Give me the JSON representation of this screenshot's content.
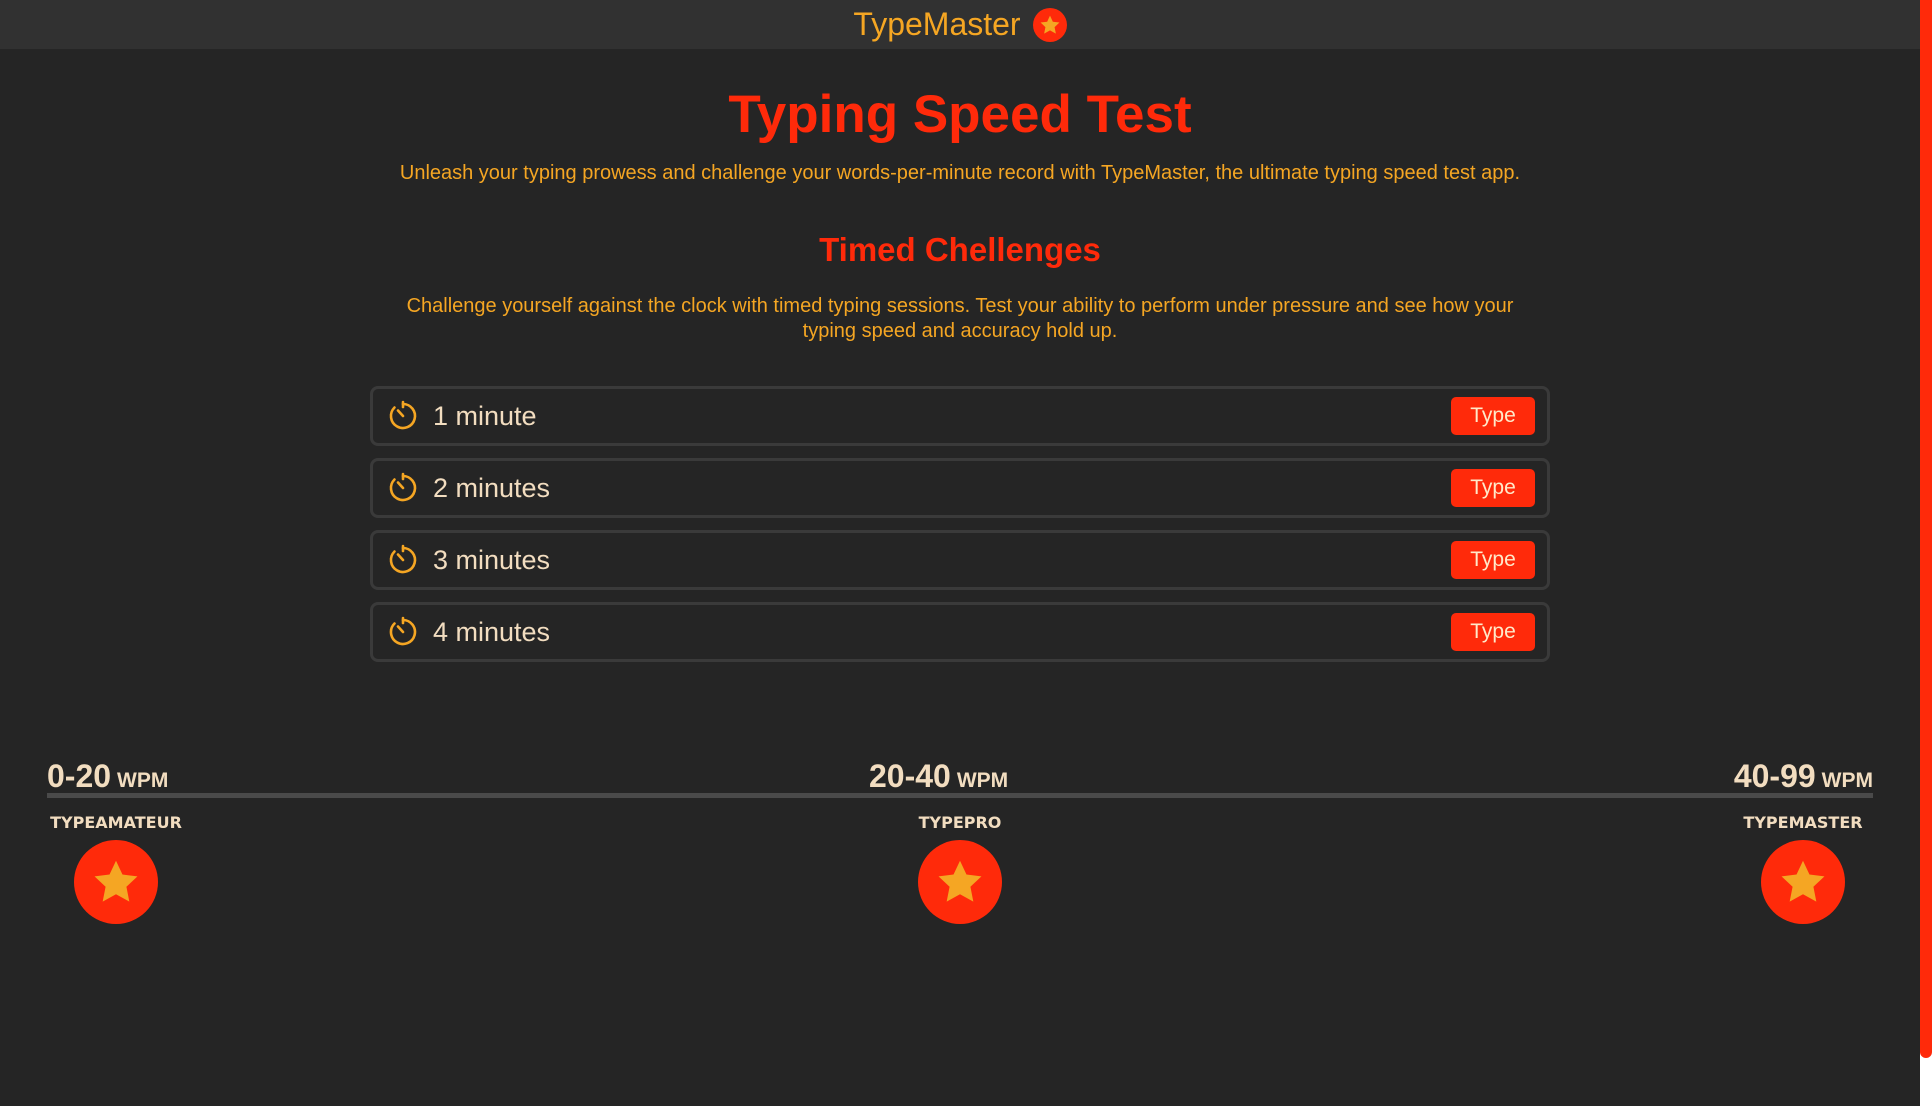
{
  "header": {
    "brand": "TypeMaster",
    "brand_icon": "star-icon"
  },
  "hero": {
    "title": "Typing Speed Test",
    "lead": "Unleash your typing prowess and challenge your words-per-minute record with TypeMaster, the ultimate typing speed test app."
  },
  "timed": {
    "title": "Timed Chellenges",
    "description": "Challenge yourself against the clock with timed typing sessions. Test your ability to perform under pressure and see how your typing speed and accuracy hold up.",
    "items": [
      {
        "label": "1 minute",
        "button": "Type",
        "icon": "timer-icon"
      },
      {
        "label": "2 minutes",
        "button": "Type",
        "icon": "timer-icon"
      },
      {
        "label": "3 minutes",
        "button": "Type",
        "icon": "timer-icon"
      },
      {
        "label": "4 minutes",
        "button": "Type",
        "icon": "timer-icon"
      }
    ]
  },
  "levels": [
    {
      "range": "0-20",
      "unit": "WPM",
      "name": "TYPEAMATEUR",
      "icon": "star-icon"
    },
    {
      "range": "20-40",
      "unit": "WPM",
      "name": "TYPEPRO",
      "icon": "star-icon"
    },
    {
      "range": "40-99",
      "unit": "WPM",
      "name": "TYPEMASTER",
      "icon": "star-icon"
    }
  ],
  "colors": {
    "background": "#252525",
    "topbar": "#313131",
    "accent": "#ff2a0a",
    "secondary": "#f5a623",
    "text_light": "#f2ddc0"
  }
}
